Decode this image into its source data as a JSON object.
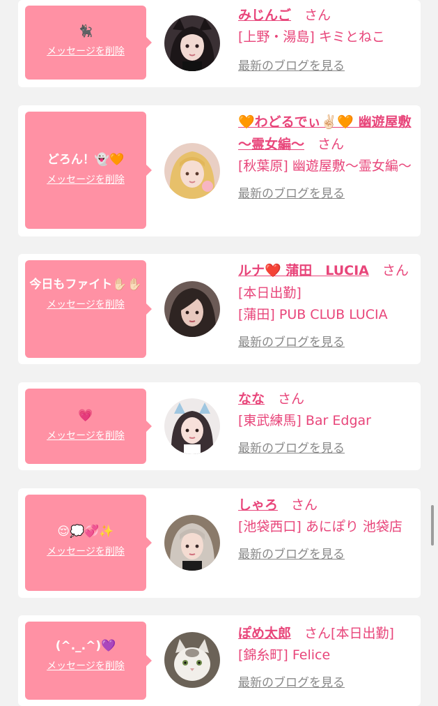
{
  "suffix_san": "さん",
  "delete_label": "メッセージを削除",
  "blog_label": "最新のブログを見る",
  "colors": {
    "accent_pink": "#e8457a",
    "bubble_pink": "#ff91a4",
    "link_gray": "#888888",
    "page_background": "#f2f2f2"
  },
  "cards": [
    {
      "message": "🐈‍⬛",
      "name": "みじんご",
      "extra": "",
      "shop": "[上野・湯島] キミとねこ",
      "avatar": "avatar-girl-cat-ears"
    },
    {
      "message": "どろん！👻🧡",
      "name": "🧡わどるでぃ✌🏻🧡 幽遊屋敷 〜霊女編〜",
      "extra": "",
      "shop": "[秋葉原] 幽遊屋敷〜霊女編〜",
      "avatar": "avatar-girl-blonde"
    },
    {
      "message": "今日もファイト✋🏻✋🏻",
      "name": "ルナ❤️ 蒲田　LUCIA",
      "extra": "[本日出勤]",
      "shop": "[蒲田] PUB CLUB LUCIA",
      "avatar": "avatar-girl-dark-hair"
    },
    {
      "message": "💗",
      "name": "なな",
      "extra": "",
      "shop": "[東武練馬] Bar Edgar",
      "avatar": "avatar-girl-maid-cat-ears"
    },
    {
      "message": "😌💭💞✨",
      "name": "しゃろ",
      "extra": "",
      "shop": "[池袋西口] あにぽり 池袋店",
      "avatar": "avatar-girl-silver-hair"
    },
    {
      "message": "(^._.^)💜",
      "name": "ぽめ太郎",
      "extra": "[本日出勤]",
      "shop": "[錦糸町] Felice",
      "avatar": "avatar-white-cat"
    }
  ]
}
